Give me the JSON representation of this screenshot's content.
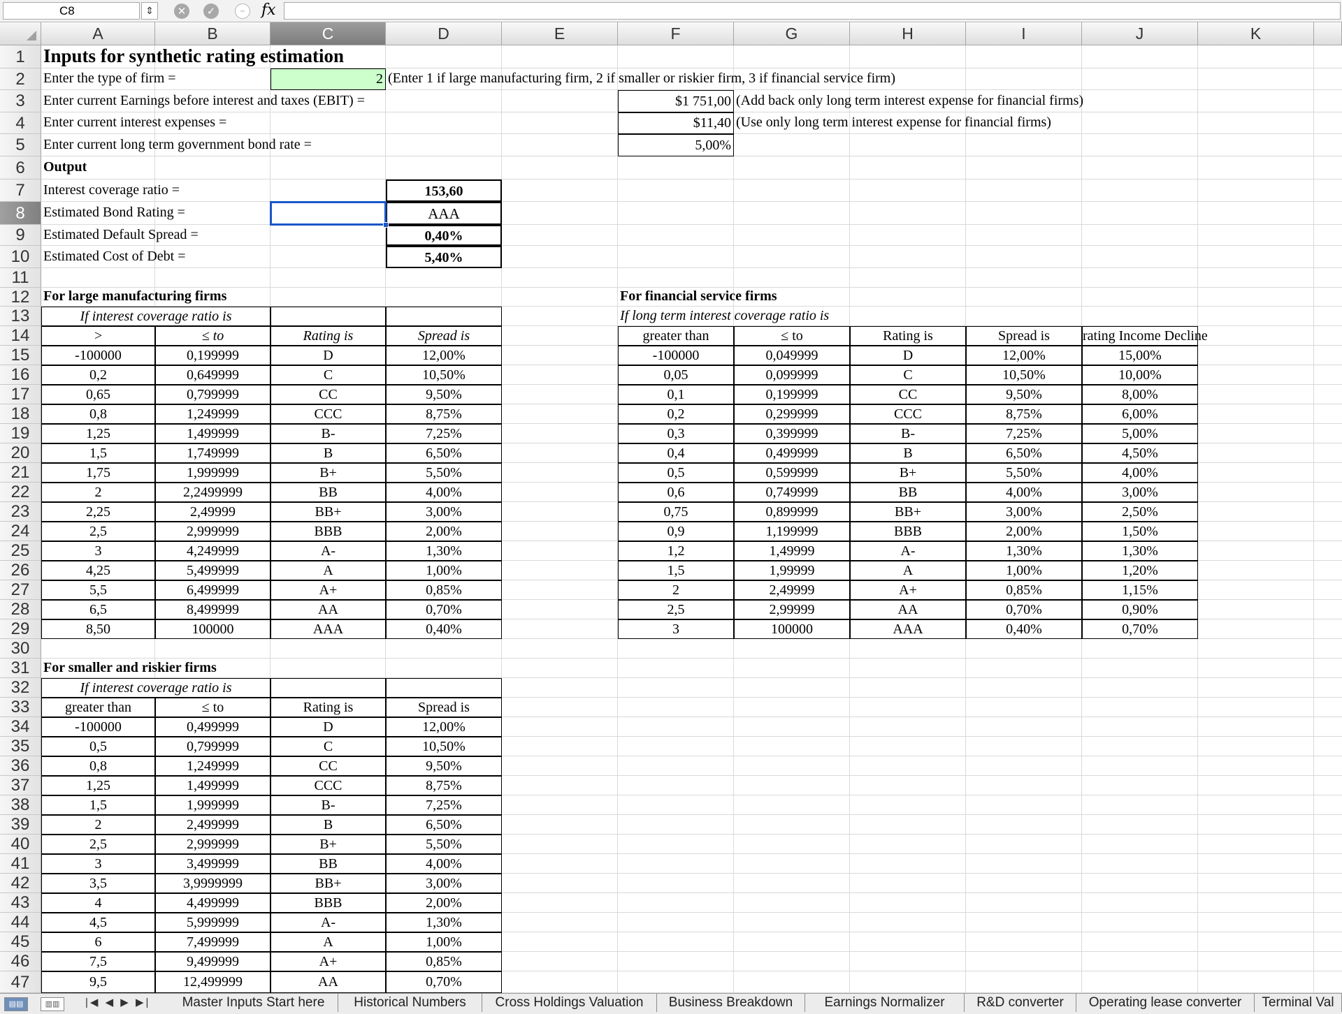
{
  "formula_bar": {
    "cell_ref": "C8",
    "fx_label": "fx",
    "formula": ""
  },
  "columns": [
    "A",
    "B",
    "C",
    "D",
    "E",
    "F",
    "G",
    "H",
    "I",
    "J",
    "K"
  ],
  "rows": [
    "1",
    "2",
    "3",
    "4",
    "5",
    "6",
    "7",
    "8",
    "9",
    "10",
    "11",
    "12",
    "13",
    "14",
    "15",
    "16",
    "17",
    "18",
    "19",
    "20",
    "21",
    "22",
    "23",
    "24",
    "25",
    "26",
    "27",
    "28",
    "29",
    "30",
    "31",
    "32",
    "33",
    "34",
    "35",
    "36",
    "37",
    "38",
    "39",
    "40",
    "41",
    "42",
    "43",
    "44",
    "45",
    "46",
    "47"
  ],
  "inputs": {
    "title": "Inputs for synthetic rating estimation",
    "firm_type_label": "Enter the type of firm =",
    "firm_type_value": "2",
    "firm_type_note": "(Enter 1 if large manufacturing firm, 2 if smaller or riskier firm, 3 if financial service firm)",
    "ebit_label": "Enter current Earnings before interest and taxes (EBIT) =",
    "ebit_value": "$1 751,00",
    "ebit_note": "(Add back only long term interest expense for financial firms)",
    "interest_label": "Enter current interest expenses =",
    "interest_value": "$11,40",
    "interest_note": "(Use only long term interest expense for financial firms)",
    "bond_rate_label": "Enter current long term government bond rate =",
    "bond_rate_value": "5,00%"
  },
  "output": {
    "heading": "Output",
    "coverage_label": "Interest  coverage ratio =",
    "coverage_value": "153,60",
    "rating_label": "Estimated Bond Rating =",
    "rating_value": "AAA",
    "spread_label": "Estimated Default Spread =",
    "spread_value": "0,40%",
    "cost_label": "Estimated Cost of Debt =",
    "cost_value": "5,40%"
  },
  "large_table": {
    "title": "For large manufacturing firms",
    "subtitle": "If interest coverage ratio is",
    "headers": [
      ">",
      "≤ to",
      "Rating is",
      "Spread is"
    ],
    "rows": [
      [
        "-100000",
        "0,199999",
        "D",
        "12,00%"
      ],
      [
        "0,2",
        "0,649999",
        "C",
        "10,50%"
      ],
      [
        "0,65",
        "0,799999",
        "CC",
        "9,50%"
      ],
      [
        "0,8",
        "1,249999",
        "CCC",
        "8,75%"
      ],
      [
        "1,25",
        "1,499999",
        "B-",
        "7,25%"
      ],
      [
        "1,5",
        "1,749999",
        "B",
        "6,50%"
      ],
      [
        "1,75",
        "1,999999",
        "B+",
        "5,50%"
      ],
      [
        "2",
        "2,2499999",
        "BB",
        "4,00%"
      ],
      [
        "2,25",
        "2,49999",
        "BB+",
        "3,00%"
      ],
      [
        "2,5",
        "2,999999",
        "BBB",
        "2,00%"
      ],
      [
        "3",
        "4,249999",
        "A-",
        "1,30%"
      ],
      [
        "4,25",
        "5,499999",
        "A",
        "1,00%"
      ],
      [
        "5,5",
        "6,499999",
        "A+",
        "0,85%"
      ],
      [
        "6,5",
        "8,499999",
        "AA",
        "0,70%"
      ],
      [
        "8,50",
        "100000",
        "AAA",
        "0,40%"
      ]
    ]
  },
  "financial_table": {
    "title": "For financial service firms",
    "subtitle": "If long term interest coverage ratio is",
    "headers": [
      "greater than",
      "≤ to",
      "Rating is",
      "Spread is",
      "rating Income Decline"
    ],
    "rows": [
      [
        "-100000",
        "0,049999",
        "D",
        "12,00%",
        "15,00%"
      ],
      [
        "0,05",
        "0,099999",
        "C",
        "10,50%",
        "10,00%"
      ],
      [
        "0,1",
        "0,199999",
        "CC",
        "9,50%",
        "8,00%"
      ],
      [
        "0,2",
        "0,299999",
        "CCC",
        "8,75%",
        "6,00%"
      ],
      [
        "0,3",
        "0,399999",
        "B-",
        "7,25%",
        "5,00%"
      ],
      [
        "0,4",
        "0,499999",
        "B",
        "6,50%",
        "4,50%"
      ],
      [
        "0,5",
        "0,599999",
        "B+",
        "5,50%",
        "4,00%"
      ],
      [
        "0,6",
        "0,749999",
        "BB",
        "4,00%",
        "3,00%"
      ],
      [
        "0,75",
        "0,899999",
        "BB+",
        "3,00%",
        "2,50%"
      ],
      [
        "0,9",
        "1,199999",
        "BBB",
        "2,00%",
        "1,50%"
      ],
      [
        "1,2",
        "1,49999",
        "A-",
        "1,30%",
        "1,30%"
      ],
      [
        "1,5",
        "1,99999",
        "A",
        "1,00%",
        "1,20%"
      ],
      [
        "2",
        "2,49999",
        "A+",
        "0,85%",
        "1,15%"
      ],
      [
        "2,5",
        "2,99999",
        "AA",
        "0,70%",
        "0,90%"
      ],
      [
        "3",
        "100000",
        "AAA",
        "0,40%",
        "0,70%"
      ]
    ]
  },
  "small_table": {
    "title": "For smaller and riskier firms",
    "subtitle": "If interest coverage ratio is",
    "headers": [
      "greater than",
      "≤ to",
      "Rating is",
      "Spread is"
    ],
    "rows": [
      [
        "-100000",
        "0,499999",
        "D",
        "12,00%"
      ],
      [
        "0,5",
        "0,799999",
        "C",
        "10,50%"
      ],
      [
        "0,8",
        "1,249999",
        "CC",
        "9,50%"
      ],
      [
        "1,25",
        "1,499999",
        "CCC",
        "8,75%"
      ],
      [
        "1,5",
        "1,999999",
        "B-",
        "7,25%"
      ],
      [
        "2",
        "2,499999",
        "B",
        "6,50%"
      ],
      [
        "2,5",
        "2,999999",
        "B+",
        "5,50%"
      ],
      [
        "3",
        "3,499999",
        "BB",
        "4,00%"
      ],
      [
        "3,5",
        "3,9999999",
        "BB+",
        "3,00%"
      ],
      [
        "4",
        "4,499999",
        "BBB",
        "2,00%"
      ],
      [
        "4,5",
        "5,999999",
        "A-",
        "1,30%"
      ],
      [
        "6",
        "7,499999",
        "A",
        "1,00%"
      ],
      [
        "7,5",
        "9,499999",
        "A+",
        "0,85%"
      ],
      [
        "9,5",
        "12,499999",
        "AA",
        "0,70%"
      ]
    ]
  },
  "tabs": {
    "nav": "|◀ ◀ ▶ ▶|",
    "sheets": [
      "Master Inputs Start here",
      "Historical Numbers",
      "Cross Holdings Valuation",
      "Business Breakdown",
      "Earnings Normalizer",
      "R&D converter",
      "Operating lease converter",
      "Terminal Val"
    ]
  }
}
